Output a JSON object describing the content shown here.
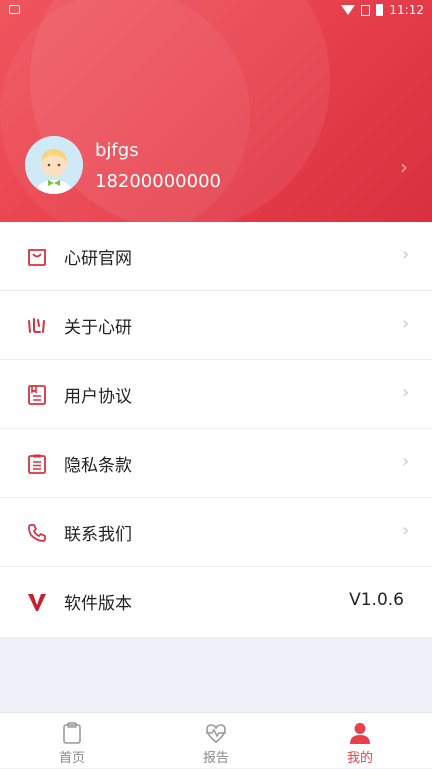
{
  "status_bar": {
    "time": "11:12"
  },
  "profile": {
    "username": "bjfgs",
    "phone": "18200000000"
  },
  "menu": [
    {
      "label": "心研官网",
      "icon": "shopping-bag-icon"
    },
    {
      "label": "关于心研",
      "icon": "brand-logo-icon"
    },
    {
      "label": "用户协议",
      "icon": "document-icon"
    },
    {
      "label": "隐私条款",
      "icon": "clipboard-icon"
    },
    {
      "label": "联系我们",
      "icon": "phone-icon"
    },
    {
      "label": "软件版本",
      "icon": "v-logo-icon",
      "value": "V1.0.6"
    }
  ],
  "tabs": [
    {
      "label": "首页",
      "icon": "clipboard-icon"
    },
    {
      "label": "报告",
      "icon": "heart-pulse-icon"
    },
    {
      "label": "我的",
      "icon": "person-icon",
      "active": true
    }
  ],
  "colors": {
    "accent": "#e8404c",
    "background": "#eef1f7"
  }
}
